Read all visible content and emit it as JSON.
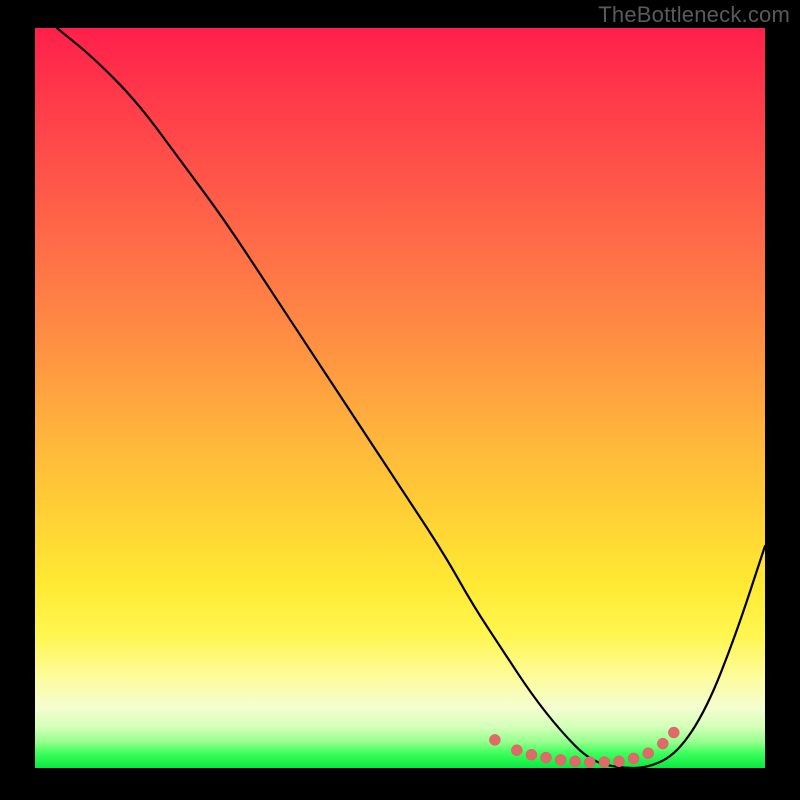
{
  "watermark": "TheBottleneck.com",
  "chart_data": {
    "type": "line",
    "title": "",
    "xlabel": "",
    "ylabel": "",
    "xlim": [
      0,
      100
    ],
    "ylim": [
      0,
      100
    ],
    "note": "Axes are unlabeled; values are normalized 0–100 estimates from pixel positions.",
    "gradient_colors": {
      "top": "#ff1f4b",
      "mid_high": "#ff8e43",
      "mid": "#ffe933",
      "low": "#fdfca0",
      "bottom": "#09e93f"
    },
    "series": [
      {
        "name": "bottleneck-curve",
        "color": "#000000",
        "x": [
          3,
          8,
          14,
          20,
          26,
          32,
          38,
          44,
          50,
          56,
          60,
          64,
          68,
          72,
          76,
          80,
          84,
          88,
          92,
          96,
          100
        ],
        "y": [
          100,
          96,
          90,
          82,
          74,
          65,
          56,
          47,
          38,
          29,
          22,
          16,
          10,
          5,
          1,
          0,
          0,
          2,
          8,
          18,
          30
        ]
      }
    ],
    "markers": {
      "name": "optimal-range-dots",
      "color": "#e06a6a",
      "points": [
        {
          "x": 63,
          "y": 3.8
        },
        {
          "x": 66,
          "y": 2.4
        },
        {
          "x": 68,
          "y": 1.8
        },
        {
          "x": 70,
          "y": 1.4
        },
        {
          "x": 72,
          "y": 1.1
        },
        {
          "x": 74,
          "y": 0.9
        },
        {
          "x": 76,
          "y": 0.8
        },
        {
          "x": 78,
          "y": 0.8
        },
        {
          "x": 80,
          "y": 0.9
        },
        {
          "x": 82,
          "y": 1.3
        },
        {
          "x": 84,
          "y": 2.0
        },
        {
          "x": 86,
          "y": 3.3
        },
        {
          "x": 87.5,
          "y": 4.8
        }
      ]
    }
  }
}
